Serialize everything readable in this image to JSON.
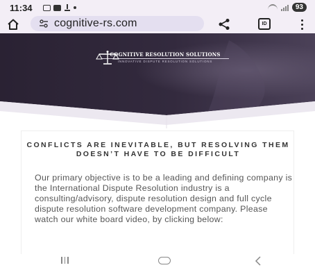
{
  "status_bar": {
    "time": "11:34",
    "battery": "93"
  },
  "browser": {
    "url": "cognitive-rs.com",
    "tabs_label": "ID"
  },
  "hero": {
    "brand_name": "COGNITIVE RESOLUTION SOLUTIONS",
    "brand_tagline": "INNOVATIVE DISPUTE RESOLUTION SOLUTIONS"
  },
  "content": {
    "headline": "CONFLICTS ARE INEVITABLE, BUT RESOLVING THEM DOESN’T HAVE TO BE DIFFICULT",
    "body": "Our primary objective is to be a leading and defining company is the International Dispute Resolution industry is a consulting/advisory, dispute resolution design and full cycle dispute resolution software development company. Please watch our white board video, by clicking below:"
  },
  "colors": {
    "hero_dark": "#2d2438",
    "hero_mid": "#4a3f55",
    "chrome_bg": "#f3eef6",
    "url_pill": "#e4dff0",
    "body_text": "#555555"
  },
  "icons": {
    "home": "home-icon",
    "tune": "tune-icon",
    "share": "share-icon",
    "menu": "more-vert-icon",
    "logo": "scales-of-justice-icon"
  }
}
